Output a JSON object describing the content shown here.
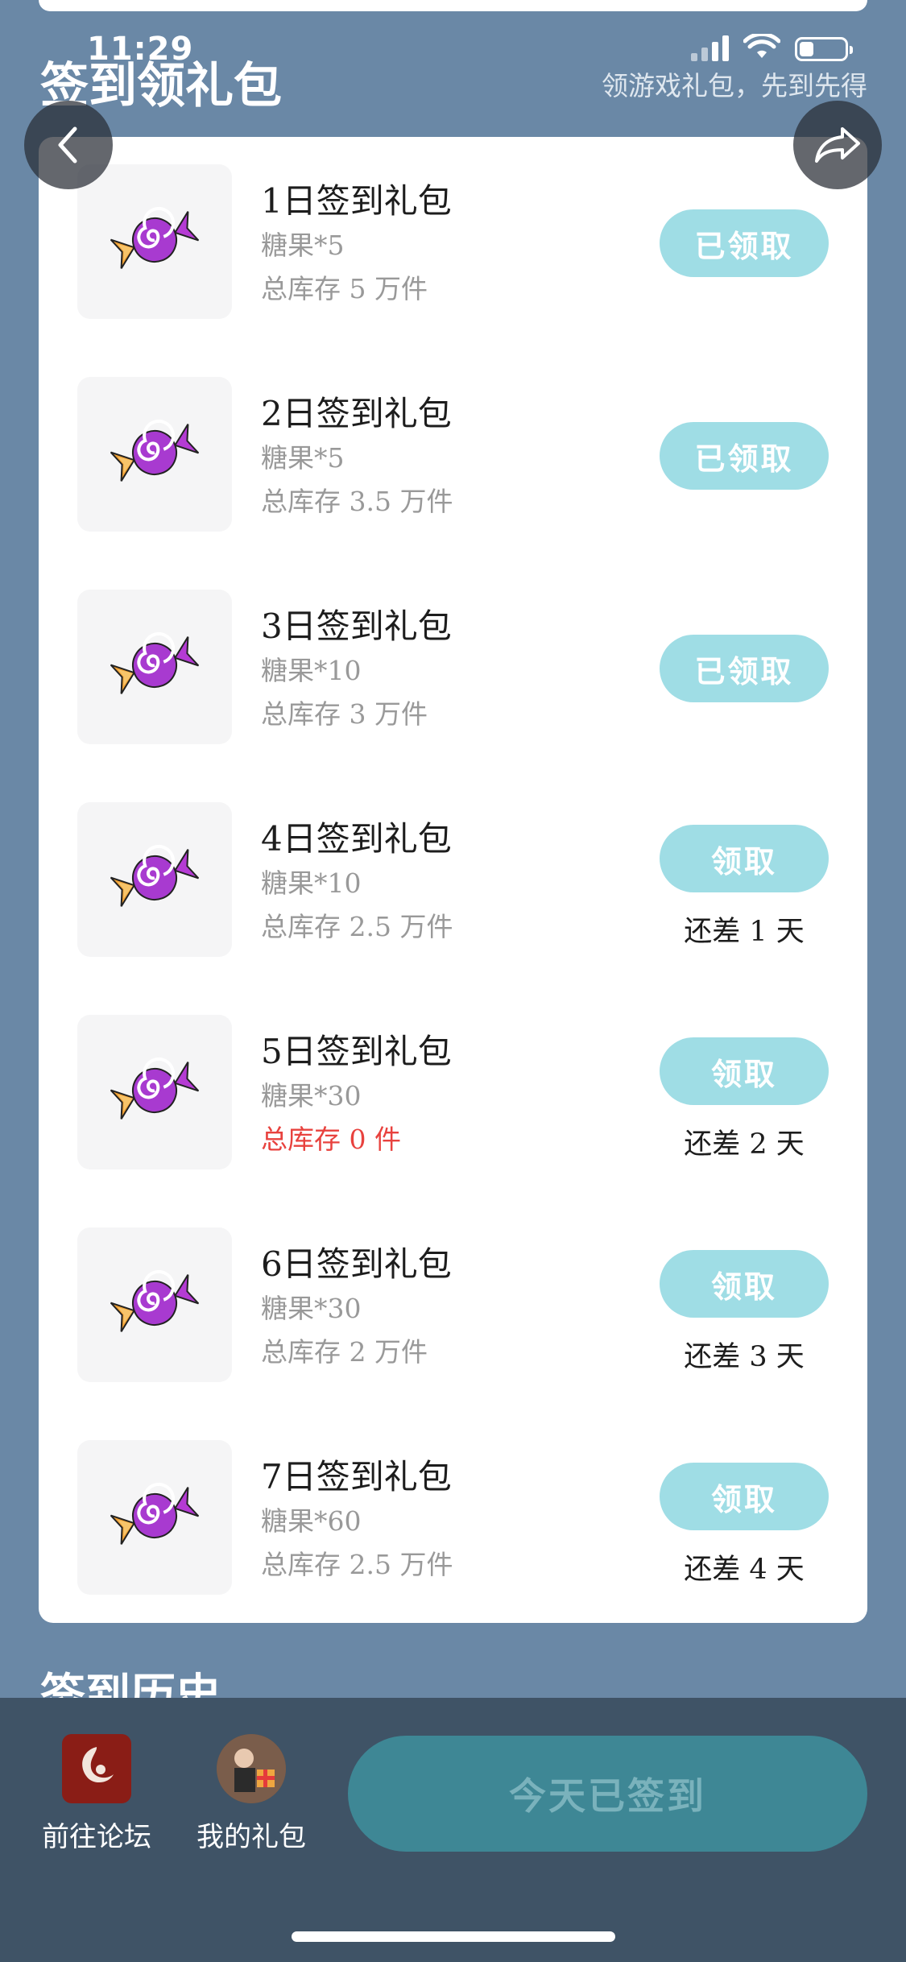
{
  "colors": {
    "background": "#6a88a6",
    "button": "#9fdde5",
    "out_of_stock": "#e8423e",
    "bottom_bar": "#3f5366"
  },
  "status_bar": {
    "time": "11:29"
  },
  "header": {
    "title": "签到领礼包",
    "subtitle": "领游戏礼包，先到先得"
  },
  "gifts": [
    {
      "title": "1日签到礼包",
      "item": "糖果*5",
      "stock": "总库存 5 万件",
      "button": "已领取",
      "state": "claimed"
    },
    {
      "title": "2日签到礼包",
      "item": "糖果*5",
      "stock": "总库存 3.5 万件",
      "button": "已领取",
      "state": "claimed"
    },
    {
      "title": "3日签到礼包",
      "item": "糖果*10",
      "stock": "总库存 3 万件",
      "button": "已领取",
      "state": "claimed"
    },
    {
      "title": "4日签到礼包",
      "item": "糖果*10",
      "stock": "总库存 2.5 万件",
      "button": "领取",
      "state": "pending",
      "days_left": "还差 1 天"
    },
    {
      "title": "5日签到礼包",
      "item": "糖果*30",
      "stock": "总库存 0 件",
      "button": "领取",
      "state": "pending",
      "days_left": "还差 2 天",
      "out_of_stock": true
    },
    {
      "title": "6日签到礼包",
      "item": "糖果*30",
      "stock": "总库存 2 万件",
      "button": "领取",
      "state": "pending",
      "days_left": "还差 3 天"
    },
    {
      "title": "7日签到礼包",
      "item": "糖果*60",
      "stock": "总库存 2.5 万件",
      "button": "领取",
      "state": "pending",
      "days_left": "还差 4 天"
    }
  ],
  "history": {
    "title": "签到历史"
  },
  "bottom_bar": {
    "forum_label": "前往论坛",
    "my_gifts_label": "我的礼包",
    "signed_label": "今天已签到"
  },
  "icons": {
    "gift_thumb": "candy-icon",
    "back": "chevron-left-icon",
    "share": "share-arrow-icon"
  }
}
